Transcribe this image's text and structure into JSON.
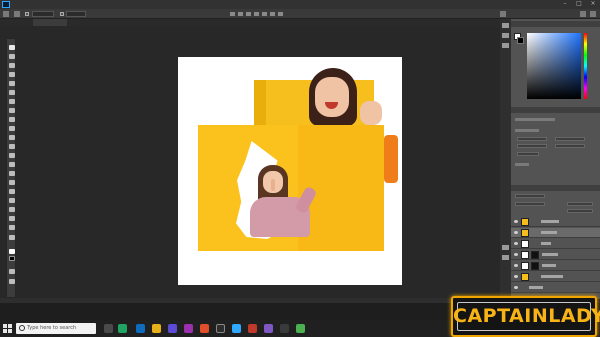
{
  "app": {
    "name": "Adobe Photoshop",
    "menu": [
      "",
      "",
      "",
      "",
      "",
      "",
      "",
      "",
      "",
      "",
      "",
      ""
    ]
  },
  "options_bar": {},
  "tabs": {
    "items": [
      {
        "label": "",
        "active": false
      },
      {
        "label": "",
        "active": true
      }
    ]
  },
  "canvas": {
    "description_colors": {
      "background": "#ffffff",
      "paper": "#fbc21d",
      "sleeve": "#ef7e1a"
    }
  },
  "panels": {
    "color": {
      "tabs": [
        "",
        "",
        "",
        ""
      ]
    },
    "properties": {
      "tabs": [
        "",
        "",
        ""
      ]
    },
    "layers": {
      "tabs": [
        "",
        "",
        ""
      ],
      "rows": [
        {
          "name": "",
          "selected": false
        },
        {
          "name": "",
          "selected": true
        },
        {
          "name": "",
          "selected": false
        },
        {
          "name": "",
          "selected": false
        },
        {
          "name": "",
          "selected": false
        },
        {
          "name": "",
          "selected": false
        },
        {
          "name": "",
          "selected": false
        }
      ]
    }
  },
  "status": {
    "zoom": ""
  },
  "taskbar": {
    "search_placeholder": "Type here to search"
  },
  "watermark": {
    "text": "CAPTAINLADY",
    "accent": "#f8b414"
  }
}
